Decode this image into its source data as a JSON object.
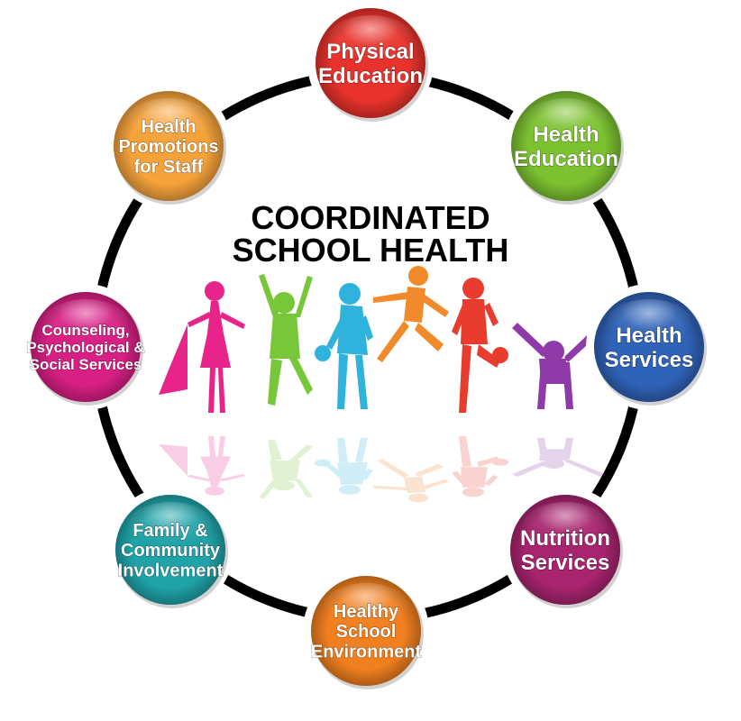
{
  "title": {
    "line1": "COORDINATED",
    "line2": "SCHOOL HEALTH"
  },
  "nodes": [
    {
      "id": "physical-education",
      "lines": [
        "Physical",
        "Education"
      ],
      "color": "#e8322b"
    },
    {
      "id": "health-education",
      "lines": [
        "Health",
        "Education"
      ],
      "color": "#7cc230"
    },
    {
      "id": "health-services",
      "lines": [
        "Health",
        "Services"
      ],
      "color": "#2f63b8"
    },
    {
      "id": "nutrition-services",
      "lines": [
        "Nutrition",
        "Services"
      ],
      "color": "#a8246f"
    },
    {
      "id": "healthy-school-environment",
      "lines": [
        "Healthy",
        "School",
        "Environment"
      ],
      "color": "#f07f1f"
    },
    {
      "id": "family-community-involvement",
      "lines": [
        "Family &",
        "Community",
        "Involvement"
      ],
      "color": "#1fa3a8"
    },
    {
      "id": "counseling-psychological-social",
      "lines": [
        "Counseling,",
        "Psychological &",
        "Social Services"
      ],
      "color": "#d81f84"
    },
    {
      "id": "health-promotions-staff",
      "lines": [
        "Health",
        "Promotions",
        "for Staff"
      ],
      "color": "#f5a23a"
    }
  ],
  "figures": [
    {
      "id": "pink-girl",
      "color": "#e8238a"
    },
    {
      "id": "green-child",
      "color": "#78c63a"
    },
    {
      "id": "blue-child",
      "color": "#2fb3dc"
    },
    {
      "id": "orange-child",
      "color": "#f08a2a"
    },
    {
      "id": "red-child",
      "color": "#e83c2e"
    },
    {
      "id": "purple-child",
      "color": "#8e3aa8"
    }
  ]
}
